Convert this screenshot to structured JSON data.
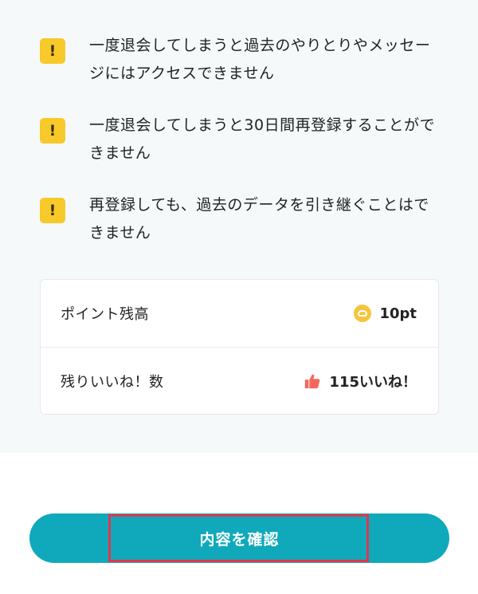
{
  "warnings": [
    {
      "icon": "exclamation-icon",
      "symbol": "!",
      "text": "一度退会してしまうと過去のやりとりやメッセージにはアクセスできません"
    },
    {
      "icon": "exclamation-icon",
      "symbol": "!",
      "text": "一度退会してしまうと30日間再登録することができません"
    },
    {
      "icon": "exclamation-icon",
      "symbol": "!",
      "text": "再登録しても、過去のデータを引き継ぐことはできません"
    }
  ],
  "balances": {
    "points": {
      "label": "ポイント残高",
      "value": "10pt",
      "icon": "coin-icon"
    },
    "likes": {
      "label": "残りいいね！数",
      "value": "115いいね！",
      "icon": "thumbs-up-icon"
    }
  },
  "confirm_button": {
    "label": "内容を確認"
  },
  "colors": {
    "accent": "#0fa9bb",
    "warning": "#f7c92a",
    "highlight": "#e0374e",
    "coin": "#f6c43c",
    "thumb": "#f2695c"
  }
}
